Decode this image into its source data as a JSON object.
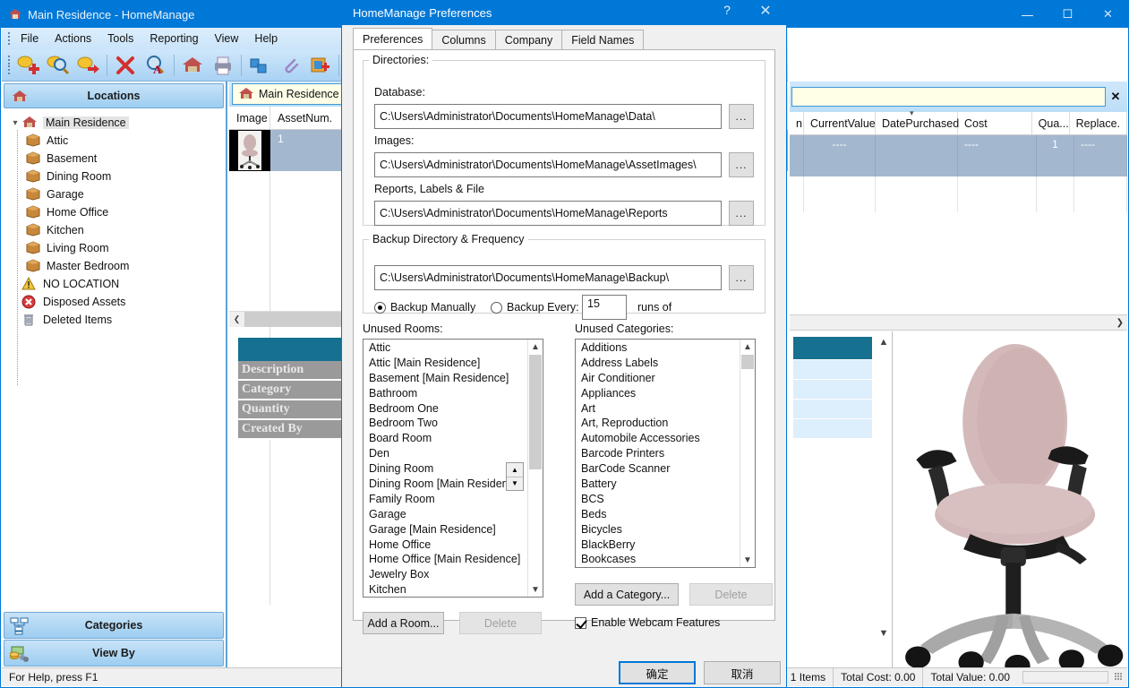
{
  "app": {
    "title": "Main Residence - HomeManage",
    "title_icon": "house-icon",
    "window_buttons": {
      "minimize": "—",
      "maximize": "☐",
      "close": "✕"
    },
    "menu": [
      "File",
      "Actions",
      "Tools",
      "Reporting",
      "View",
      "Help"
    ],
    "toolbar_icons": [
      "add-item-icon",
      "find-item-icon",
      "goto-item-icon",
      "delete-item-icon",
      "find-text-icon",
      "location-icon",
      "print-icon",
      "duplicate-icon",
      "attachment-icon",
      "new-image-icon",
      "barcode-icon"
    ],
    "status": {
      "help_text": "For Help, press F1",
      "items_count": "1 Items",
      "total_cost": "Total Cost: 0.00",
      "total_value": "Total Value: 0.00"
    }
  },
  "left_pane": {
    "header": "Locations",
    "tree": [
      {
        "label": "Main Residence",
        "icon": "house-icon",
        "level": 0,
        "expanded": true,
        "selected": true
      },
      {
        "label": "Attic",
        "icon": "box-icon",
        "level": 1
      },
      {
        "label": "Basement",
        "icon": "box-icon",
        "level": 1
      },
      {
        "label": "Dining Room",
        "icon": "box-icon",
        "level": 1
      },
      {
        "label": "Garage",
        "icon": "box-icon",
        "level": 1
      },
      {
        "label": "Home Office",
        "icon": "box-icon",
        "level": 1
      },
      {
        "label": "Kitchen",
        "icon": "box-icon",
        "level": 1
      },
      {
        "label": "Living Room",
        "icon": "box-icon",
        "level": 1
      },
      {
        "label": "Master Bedroom",
        "icon": "box-icon",
        "level": 1
      },
      {
        "label": "NO LOCATION",
        "icon": "warning-icon",
        "level": 0
      },
      {
        "label": "Disposed Assets",
        "icon": "disposed-icon",
        "level": 0
      },
      {
        "label": "Deleted Items",
        "icon": "trash-icon",
        "level": 0
      }
    ],
    "buttons": [
      {
        "label": "Categories",
        "icon": "categories-icon"
      },
      {
        "label": "View By",
        "icon": "viewby-icon"
      }
    ]
  },
  "center_pane": {
    "tab": {
      "label": "Main Residence",
      "icon": "house-icon"
    },
    "columns": [
      "Image",
      "AssetNum."
    ],
    "rows": [
      {
        "image": "office-chair-thumbnail",
        "assetnum": "1"
      }
    ],
    "detail_labels": [
      "Description",
      "Category",
      "Quantity",
      "Created By"
    ]
  },
  "right_pane": {
    "search_value": "",
    "search_clear": "✕",
    "columns": [
      "n",
      "CurrentValue",
      "DatePurchased",
      "Cost",
      "Qua...",
      "Replace."
    ],
    "row": {
      "currentvalue": "----",
      "datepurchased": "",
      "cost": "----",
      "quantity": "1",
      "replace": "----"
    },
    "image_alt": "office-chair-photo"
  },
  "dialog": {
    "title": "HomeManage Preferences",
    "help_glyph": "?",
    "close_glyph": "✕",
    "tabs": [
      {
        "label": "Preferences",
        "active": true
      },
      {
        "label": "Columns",
        "active": false
      },
      {
        "label": "Company",
        "active": false
      },
      {
        "label": "Field Names",
        "active": false
      }
    ],
    "directories": {
      "legend": "Directories:",
      "database_label": "Database:",
      "database_value": "C:\\Users\\Administrator\\Documents\\HomeManage\\Data\\",
      "images_label": "Images:",
      "images_value": "C:\\Users\\Administrator\\Documents\\HomeManage\\AssetImages\\",
      "reports_label": "Reports, Labels & File",
      "reports_value": "C:\\Users\\Administrator\\Documents\\HomeManage\\Reports",
      "browse_label": "..."
    },
    "backup": {
      "legend": "Backup Directory & Frequency",
      "path_value": "C:\\Users\\Administrator\\Documents\\HomeManage\\Backup\\",
      "browse_label": "...",
      "manual_label": "Backup Manually",
      "manual_selected": true,
      "every_label": "Backup Every:",
      "every_selected": false,
      "every_value": "15",
      "runs_of_label": "runs of"
    },
    "unused_rooms": {
      "label": "Unused Rooms:",
      "items": [
        "Attic",
        "Attic [Main Residence]",
        "Basement [Main Residence]",
        "Bathroom",
        "Bedroom One",
        "Bedroom Two",
        "Board Room",
        "Den",
        "Dining Room",
        "Dining Room [Main Residence]",
        "Family Room",
        "Garage",
        "Garage [Main Residence]",
        "Home Office",
        "Home Office [Main Residence]",
        "Jewelry Box",
        "Kitchen"
      ],
      "add_label": "Add a Room...",
      "delete_label": "Delete",
      "delete_disabled": true
    },
    "unused_categories": {
      "label": "Unused Categories:",
      "items": [
        "Additions",
        "Address Labels",
        "Air Conditioner",
        "Appliances",
        "Art",
        "Art, Reproduction",
        "Automobile Accessories",
        "Barcode Printers",
        "BarCode Scanner",
        "Battery",
        "BCS",
        "Beds",
        "Bicycles",
        "BlackBerry",
        "Bookcases"
      ],
      "add_label": "Add a Category...",
      "delete_label": "Delete",
      "delete_disabled": true
    },
    "webcam": {
      "label": "Enable Webcam Features",
      "checked": true
    },
    "ok_label": "确定",
    "cancel_label": "取消"
  },
  "colors": {
    "accent": "#0078d7",
    "teal": "#16708f",
    "row_selected": "#a3b8cf",
    "search_bg": "#ffffe8"
  }
}
